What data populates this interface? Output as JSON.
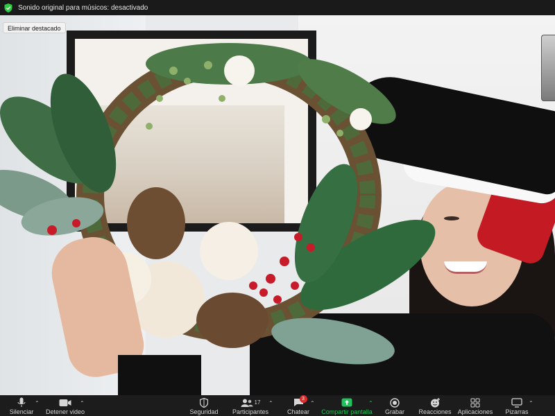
{
  "topbar": {
    "text": "Sonido original para músicos: desactivado",
    "shield_icon": "shield-check-icon",
    "shield_color": "#2ecc40"
  },
  "video": {
    "pin_label": "Eliminar destacado"
  },
  "toolbar": {
    "mute_label": "Silenciar",
    "stop_video_label": "Detener video",
    "security_label": "Seguridad",
    "participants_label": "Participantes",
    "participants_count": "17",
    "chat_label": "Chatear",
    "chat_badge": "3",
    "share_label": "Compartir pantalla",
    "record_label": "Grabar",
    "reactions_label": "Reacciones",
    "apps_label": "Aplicaciones",
    "whiteboards_label": "Pizarras",
    "share_color": "#20c25a",
    "badge_color": "#e02a2a"
  }
}
